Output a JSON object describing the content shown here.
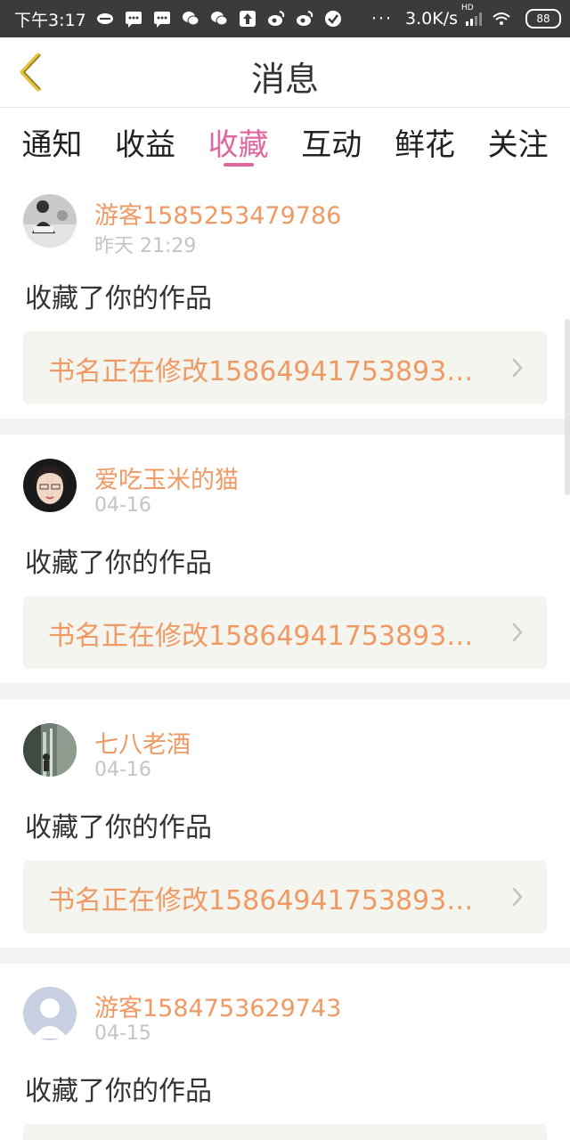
{
  "status_bar": {
    "time": "下午3:17",
    "dots": "···",
    "speed": "3.0K/s",
    "network_label": "HD",
    "battery": "88",
    "icons": [
      "vpn-icon",
      "message-icon",
      "message-icon",
      "wechat-icon",
      "wechat-icon",
      "upload-icon",
      "weibo-icon",
      "weibo-icon",
      "check-icon",
      "signal-icon",
      "wifi-icon",
      "battery-icon"
    ]
  },
  "header": {
    "title": "消息",
    "back_icon": "chevron-left-icon"
  },
  "tabs": [
    {
      "label": "通知",
      "active": false
    },
    {
      "label": "收益",
      "active": false
    },
    {
      "label": "收藏",
      "active": true
    },
    {
      "label": "互动",
      "active": false
    },
    {
      "label": "鲜花",
      "active": false
    },
    {
      "label": "关注",
      "active": false
    }
  ],
  "messages": [
    {
      "user": "游客1585253479786",
      "time": "昨天 21:29",
      "action": "收藏了你的作品",
      "work": "书名正在修改15864941753893…"
    },
    {
      "user": "爱吃玉米的猫",
      "time": "04-16",
      "action": "收藏了你的作品",
      "work": "书名正在修改15864941753893…"
    },
    {
      "user": "七八老酒",
      "time": "04-16",
      "action": "收藏了你的作品",
      "work": "书名正在修改15864941753893…"
    },
    {
      "user": "游客1584753629743",
      "time": "04-15",
      "action": "收藏了你的作品",
      "work": ""
    }
  ],
  "colors": {
    "accent_pink": "#e0669f",
    "username_orange": "#ef9a64",
    "back_chevron": "#e5c23a",
    "card_box": "#f5f5ef",
    "status_bar_bg": "#3b3b3b"
  }
}
